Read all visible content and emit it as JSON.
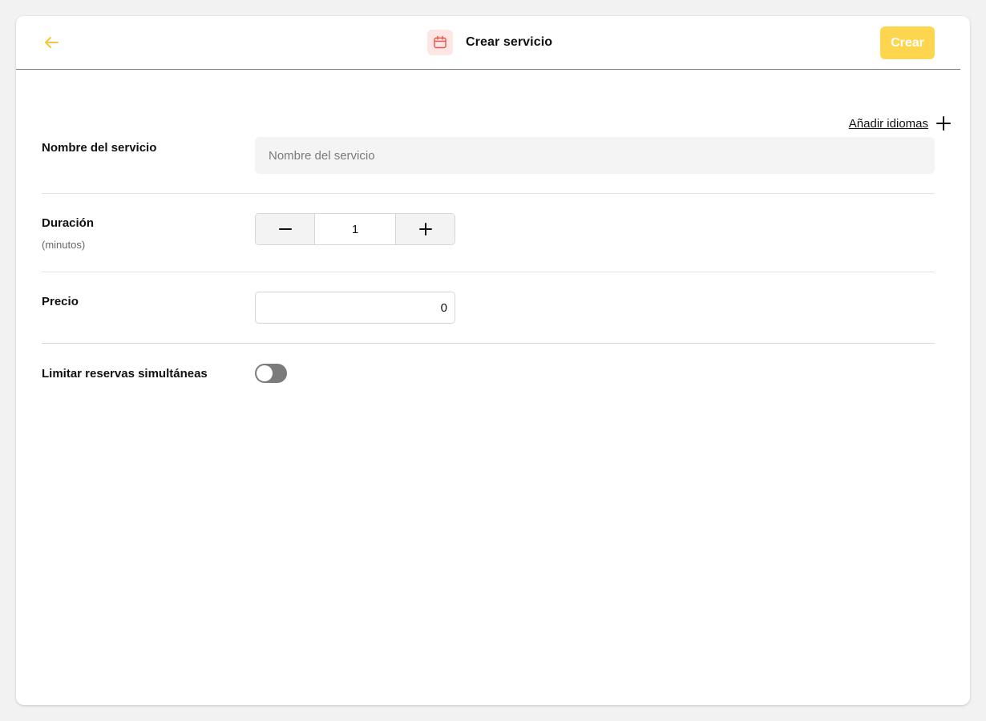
{
  "header": {
    "title": "Crear servicio",
    "create_label": "Crear",
    "back_icon": "arrow-left-icon",
    "title_icon": "calendar-icon"
  },
  "languages": {
    "add_label": "Añadir idiomas",
    "icon": "plus-icon"
  },
  "fields": {
    "name": {
      "label": "Nombre del servicio",
      "placeholder": "Nombre del servicio",
      "value": ""
    },
    "duration": {
      "label": "Duración",
      "sublabel": "(minutos)",
      "value": "1"
    },
    "price": {
      "label": "Precio",
      "value": "0"
    },
    "limit": {
      "label": "Limitar reservas simultáneas",
      "enabled": false
    }
  },
  "colors": {
    "accent": "#fdd54f",
    "back_arrow": "#f5c53a",
    "calendar_icon": "#e8564a",
    "calendar_bg": "#fde6e4",
    "toggle_off": "#7b7b7b"
  }
}
